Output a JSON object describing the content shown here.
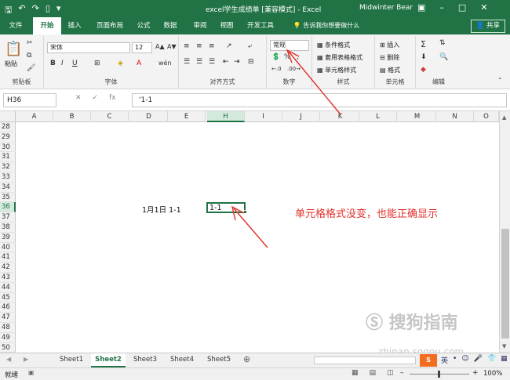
{
  "titlebar": {
    "title": "excel学生成绩单 [兼容模式] - Excel",
    "user": "Midwinter Bear"
  },
  "tabs": [
    "文件",
    "开始",
    "插入",
    "页面布局",
    "公式",
    "数据",
    "审阅",
    "视图",
    "开发工具"
  ],
  "tell_me": "告诉我你想要做什么",
  "share_label": "共享",
  "ribbon": {
    "paste_label": "粘贴",
    "font_name": "宋体",
    "font_size": "12",
    "number_format": "常规",
    "styles": [
      "条件格式",
      "套用表格格式",
      "单元格样式"
    ],
    "cells": [
      "插入",
      "删除",
      "格式"
    ],
    "group_labels": [
      "剪贴板",
      "字体",
      "对齐方式",
      "数字",
      "样式",
      "单元格",
      "编辑"
    ]
  },
  "formula_bar": {
    "name_box": "H36",
    "formula": "'1-1"
  },
  "columns": [
    "A",
    "B",
    "C",
    "D",
    "E",
    "H",
    "I",
    "J",
    "K",
    "L",
    "M",
    "N",
    "O"
  ],
  "selected_column": "H",
  "rows": [
    "28",
    "29",
    "30",
    "31",
    "32",
    "33",
    "34",
    "35",
    "36",
    "37",
    "38",
    "39",
    "40",
    "41",
    "42",
    "43",
    "44",
    "45",
    "46",
    "47",
    "48",
    "49",
    "50"
  ],
  "selected_row": "36",
  "cells": {
    "date_cell": "1月1日 1-1",
    "h36": "1-1"
  },
  "annotation": "单元格格式没变，也能正确显示",
  "sheets": [
    "Sheet1",
    "Sheet2",
    "Sheet3",
    "Sheet4",
    "Sheet5"
  ],
  "active_sheet": "Sheet2",
  "status": {
    "ready": "就绪",
    "zoom": "100%"
  },
  "watermark": {
    "text": "搜狗指南",
    "url": "zhinan.sogou.com"
  },
  "colors": {
    "excel_green": "#217346",
    "annotation_red": "#e0302b"
  }
}
